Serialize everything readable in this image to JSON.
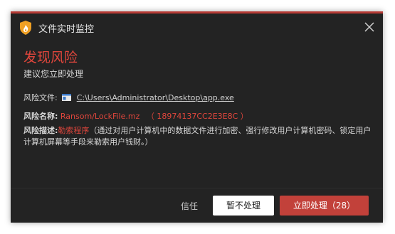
{
  "window": {
    "title": "文件实时监控"
  },
  "alert": {
    "headline": "发现风险",
    "subtext": "建议您立即处理"
  },
  "details": {
    "file_label": "风险文件:",
    "file_path": "C:\\Users\\Administrator\\Desktop\\app.exe",
    "name_label": "风险名称:",
    "risk_name": "Ransom/LockFile.mz",
    "risk_id": "（ 18974137CC2E3E8C ）",
    "desc_label": "风险描述:",
    "desc_type": "勒索程序",
    "desc_text": "（通过对用户计算机中的数据文件进行加密、强行修改用户计算机密码、锁定用户计算机屏幕等手段来勒索用户钱财。）"
  },
  "footer": {
    "trust_label": "信任",
    "ignore_label": "暂不处理",
    "handle_label": "立即处理（28）"
  },
  "colors": {
    "accent": "#c2413a",
    "danger_text": "#e0463c",
    "background": "#232323"
  },
  "icons": {
    "app": "shield-flame-icon",
    "close": "close-icon",
    "file": "window-file-icon"
  }
}
